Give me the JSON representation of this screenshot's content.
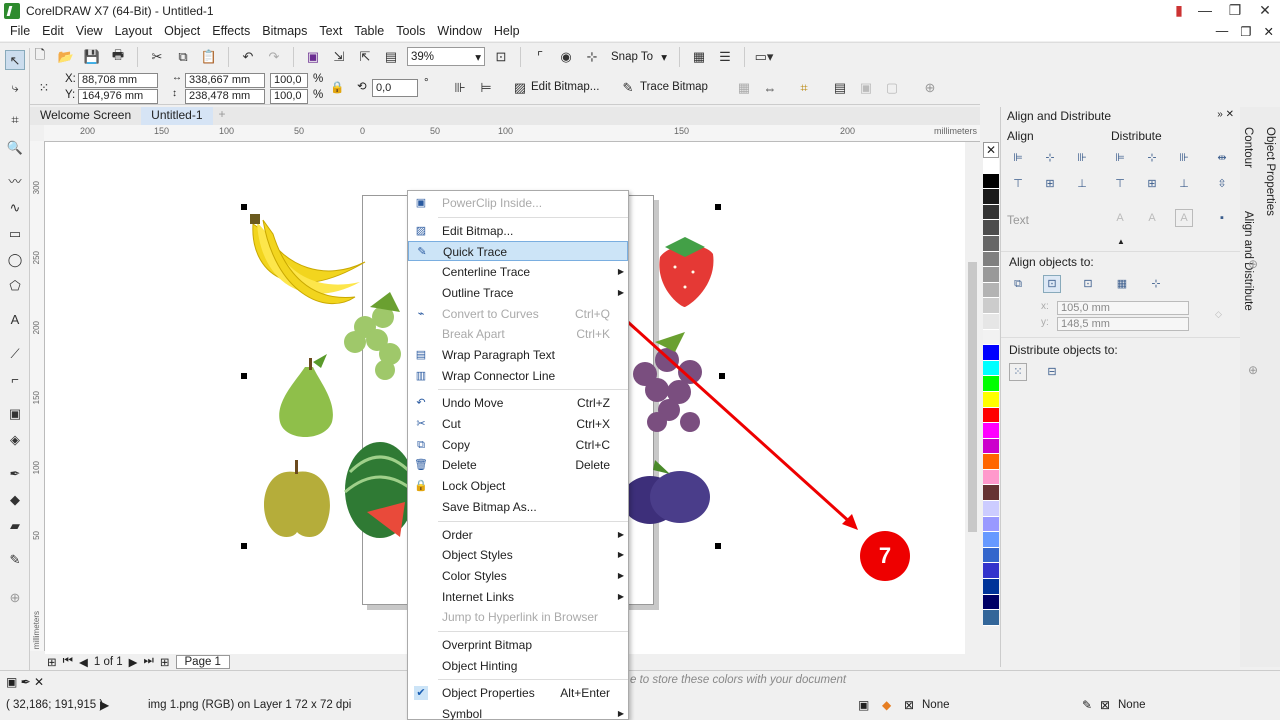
{
  "window": {
    "title": "CorelDRAW X7 (64-Bit) - Untitled-1"
  },
  "menu": [
    "File",
    "Edit",
    "View",
    "Layout",
    "Object",
    "Effects",
    "Bitmaps",
    "Text",
    "Table",
    "Tools",
    "Window",
    "Help"
  ],
  "toolbar": {
    "zoom": "39%",
    "snap": "Snap To"
  },
  "propbar": {
    "x_label": "X:",
    "x": "88,708 mm",
    "y_label": "Y:",
    "y": "164,976 mm",
    "w": "338,667 mm",
    "h": "238,478 mm",
    "sx": "100,0",
    "sy": "100,0",
    "pct": "%",
    "rot": "0,0",
    "deg": "°",
    "edit_bitmap": "Edit Bitmap...",
    "trace_bitmap": "Trace Bitmap"
  },
  "tabs": [
    "Welcome Screen",
    "Untitled-1"
  ],
  "ruler": {
    "ticks": [
      "200",
      "150",
      "100",
      "50",
      "0",
      "50",
      "100",
      "150",
      "200"
    ],
    "unit": "millimeters",
    "vticks": [
      "300",
      "250",
      "200",
      "150",
      "100",
      "50"
    ],
    "vunit": "millimeters"
  },
  "pagenav": {
    "pages": "1 of 1",
    "page_tab": "Page 1"
  },
  "docker": {
    "title": "Align and Distribute",
    "align": "Align",
    "distribute": "Distribute",
    "text": "Text",
    "align_to": "Align objects to:",
    "x_val": "105,0 mm",
    "y_val": "148,5 mm",
    "x_lbl": "x:",
    "y_lbl": "y:",
    "distribute_to": "Distribute objects to:"
  },
  "sidetabs": [
    "Contour",
    "Align and Distribute",
    "Object Properties"
  ],
  "context_menu": [
    {
      "label": "PowerClip Inside...",
      "disabled": true,
      "icon": "powerclip-icon"
    },
    {
      "sep": true
    },
    {
      "label": "Edit Bitmap...",
      "icon": "edit-bitmap-icon"
    },
    {
      "label": "Quick Trace",
      "highlighted": true,
      "icon": "quick-trace-icon"
    },
    {
      "label": "Centerline Trace",
      "submenu": true
    },
    {
      "label": "Outline Trace",
      "submenu": true
    },
    {
      "label": "Convert to Curves",
      "shortcut": "Ctrl+Q",
      "disabled": true,
      "icon": "convert-curves-icon"
    },
    {
      "label": "Break Apart",
      "shortcut": "Ctrl+K",
      "disabled": true
    },
    {
      "label": "Wrap Paragraph Text",
      "icon": "wrap-text-icon"
    },
    {
      "label": "Wrap Connector Line",
      "icon": "wrap-connector-icon"
    },
    {
      "sep": true
    },
    {
      "label": "Undo Move",
      "shortcut": "Ctrl+Z",
      "icon": "undo-icon"
    },
    {
      "label": "Cut",
      "shortcut": "Ctrl+X",
      "icon": "scissors-icon"
    },
    {
      "label": "Copy",
      "shortcut": "Ctrl+C",
      "icon": "copy-icon"
    },
    {
      "label": "Delete",
      "shortcut": "Delete",
      "icon": "trash-icon"
    },
    {
      "label": "Lock Object",
      "icon": "lock-icon"
    },
    {
      "label": "Save Bitmap As..."
    },
    {
      "sep": true
    },
    {
      "label": "Order",
      "submenu": true
    },
    {
      "label": "Object Styles",
      "submenu": true
    },
    {
      "label": "Color Styles",
      "submenu": true
    },
    {
      "label": "Internet Links",
      "submenu": true
    },
    {
      "label": "Jump to Hyperlink in Browser",
      "disabled": true
    },
    {
      "sep": true
    },
    {
      "label": "Overprint Bitmap"
    },
    {
      "label": "Object Hinting"
    },
    {
      "sep": true
    },
    {
      "label": "Object Properties",
      "shortcut": "Alt+Enter",
      "icon": "check-icon"
    },
    {
      "label": "Symbol",
      "submenu": true
    }
  ],
  "status": {
    "coords": "( 32,186; 191,915 )",
    "info": "img 1.png (RGB) on Layer 1 72 x 72 dpi",
    "hint": "e to store these colors with your document",
    "fill": "None",
    "outline": "None"
  },
  "badge": "7",
  "palette": [
    "#ffffff",
    "#000000",
    "#1a1a1a",
    "#333333",
    "#4d4d4d",
    "#666666",
    "#808080",
    "#999999",
    "#b3b3b3",
    "#cccccc",
    "#e6e6e6",
    "#f2f2f2",
    "#0000ff",
    "#00ffff",
    "#00ff00",
    "#ffff00",
    "#ff0000",
    "#ff00ff",
    "#cc00cc",
    "#ff6600",
    "#ff99cc",
    "#663333",
    "#ccccff",
    "#9999ff",
    "#6699ff",
    "#3366cc",
    "#3333cc",
    "#003399",
    "#000066",
    "#336699"
  ]
}
